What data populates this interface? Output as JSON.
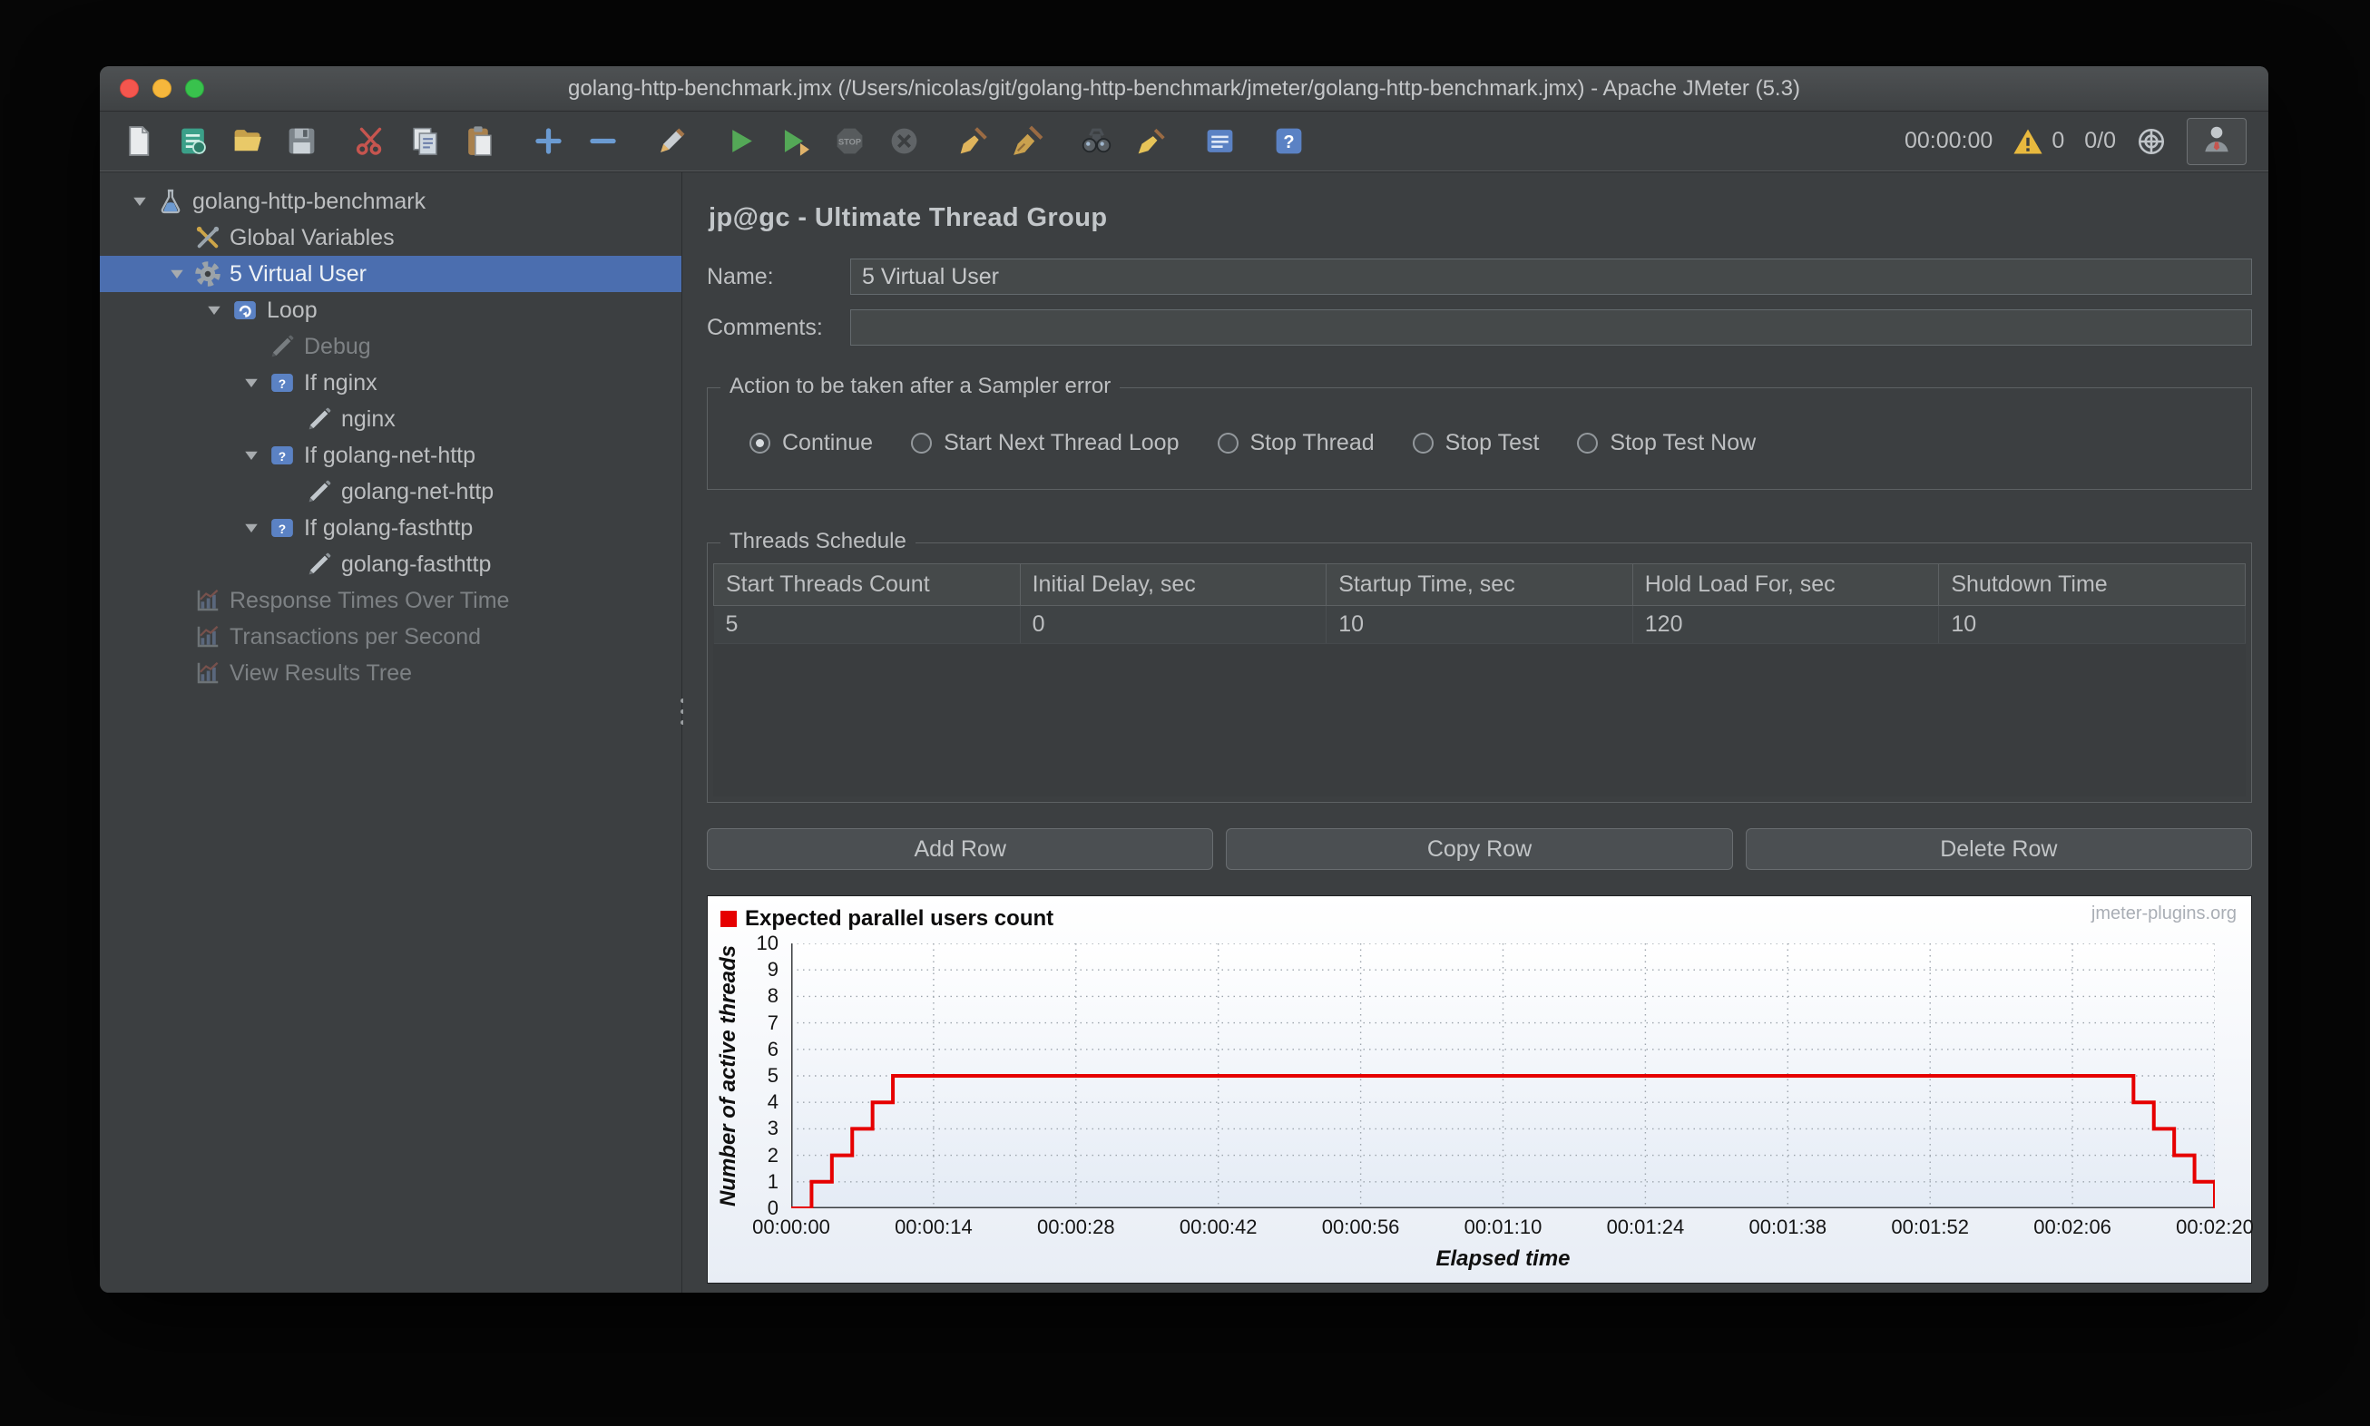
{
  "window": {
    "title": "golang-http-benchmark.jmx (/Users/nicolas/git/golang-http-benchmark/jmeter/golang-http-benchmark.jmx) - Apache JMeter (5.3)"
  },
  "colors": {
    "tree_selection": "#4b6eaf",
    "series_red": "#e60000"
  },
  "toolbar": {
    "icons": [
      {
        "name": "new-file-icon"
      },
      {
        "name": "templates-icon"
      },
      {
        "name": "open-file-icon"
      },
      {
        "name": "save-icon"
      },
      {
        "name": "cut-icon",
        "gap": true
      },
      {
        "name": "copy-icon"
      },
      {
        "name": "paste-icon"
      },
      {
        "name": "add-icon",
        "gap": true
      },
      {
        "name": "remove-icon"
      },
      {
        "name": "toggle-icon",
        "gap": true
      },
      {
        "name": "start-icon",
        "gap": true
      },
      {
        "name": "start-no-timers-icon"
      },
      {
        "name": "stop-icon",
        "disabled": true
      },
      {
        "name": "shutdown-icon",
        "disabled": true
      },
      {
        "name": "clear-icon",
        "gap": true
      },
      {
        "name": "clear-all-icon"
      },
      {
        "name": "search-icon",
        "gap": true
      },
      {
        "name": "clear-search-icon"
      },
      {
        "name": "function-helper-icon",
        "gap": true
      },
      {
        "name": "help-icon",
        "gap": true
      }
    ],
    "timer": "00:00:00",
    "warning_count": "0",
    "active_threads": "0/0"
  },
  "tree": {
    "items": [
      {
        "label": "golang-http-benchmark",
        "level": 0,
        "icon": "test-plan",
        "expanded": true,
        "enabled": true
      },
      {
        "label": "Global Variables",
        "level": 1,
        "icon": "variables",
        "enabled": true
      },
      {
        "label": "5 Virtual User",
        "level": 1,
        "icon": "thread-group",
        "expanded": true,
        "selected": true,
        "enabled": true
      },
      {
        "label": "Loop",
        "level": 2,
        "icon": "loop-controller",
        "expanded": true,
        "enabled": true
      },
      {
        "label": "Debug",
        "level": 3,
        "icon": "sampler",
        "enabled": false
      },
      {
        "label": "If nginx",
        "level": 3,
        "icon": "if-controller",
        "expanded": true,
        "enabled": true
      },
      {
        "label": "nginx",
        "level": 4,
        "icon": "sampler",
        "enabled": true
      },
      {
        "label": "If golang-net-http",
        "level": 3,
        "icon": "if-controller",
        "expanded": true,
        "enabled": true
      },
      {
        "label": "golang-net-http",
        "level": 4,
        "icon": "sampler",
        "enabled": true
      },
      {
        "label": "If golang-fasthttp",
        "level": 3,
        "icon": "if-controller",
        "expanded": true,
        "enabled": true
      },
      {
        "label": "golang-fasthttp",
        "level": 4,
        "icon": "sampler",
        "enabled": true
      },
      {
        "label": "Response Times Over Time",
        "level": 1,
        "icon": "listener",
        "enabled": false
      },
      {
        "label": "Transactions per Second",
        "level": 1,
        "icon": "listener",
        "enabled": false
      },
      {
        "label": "View Results Tree",
        "level": 1,
        "icon": "listener",
        "enabled": false
      }
    ]
  },
  "main": {
    "title": "jp@gc - Ultimate Thread Group",
    "name": {
      "label": "Name:",
      "value": "5 Virtual User"
    },
    "comments": {
      "label": "Comments:",
      "value": ""
    },
    "error_action": {
      "title": "Action to be taken after a Sampler error",
      "options": [
        {
          "label": "Continue",
          "selected": true
        },
        {
          "label": "Start Next Thread Loop",
          "selected": false
        },
        {
          "label": "Stop Thread",
          "selected": false
        },
        {
          "label": "Stop Test",
          "selected": false
        },
        {
          "label": "Stop Test Now",
          "selected": false
        }
      ]
    },
    "threads_schedule": {
      "title": "Threads Schedule",
      "columns": [
        "Start Threads Count",
        "Initial Delay, sec",
        "Startup Time, sec",
        "Hold Load For, sec",
        "Shutdown Time"
      ],
      "rows": [
        [
          "5",
          "0",
          "10",
          "120",
          "10"
        ]
      ]
    },
    "row_buttons": [
      {
        "label": "Add Row"
      },
      {
        "label": "Copy Row"
      },
      {
        "label": "Delete Row"
      }
    ]
  },
  "chart_data": {
    "type": "line",
    "title": "Expected parallel users count",
    "watermark": "jmeter-plugins.org",
    "xlabel": "Elapsed time",
    "ylabel": "Number of active threads",
    "ylim": [
      0,
      10
    ],
    "y_tick_step": 1,
    "xlim_seconds": [
      0,
      140
    ],
    "grid": true,
    "legend_position": "top-left",
    "x_ticks": [
      {
        "t": 0,
        "label": "00:00:00"
      },
      {
        "t": 14,
        "label": "00:00:14"
      },
      {
        "t": 28,
        "label": "00:00:28"
      },
      {
        "t": 42,
        "label": "00:00:42"
      },
      {
        "t": 56,
        "label": "00:00:56"
      },
      {
        "t": 70,
        "label": "00:01:10"
      },
      {
        "t": 84,
        "label": "00:01:24"
      },
      {
        "t": 98,
        "label": "00:01:38"
      },
      {
        "t": 112,
        "label": "00:01:52"
      },
      {
        "t": 126,
        "label": "00:02:06"
      },
      {
        "t": 140,
        "label": "00:02:20"
      }
    ],
    "series": [
      {
        "name": "Expected parallel users count",
        "color": "#e60000",
        "interpolation": "step-after",
        "points": [
          [
            0,
            0
          ],
          [
            2,
            1
          ],
          [
            4,
            2
          ],
          [
            6,
            3
          ],
          [
            8,
            4
          ],
          [
            10,
            5
          ],
          [
            130,
            5
          ],
          [
            132,
            4
          ],
          [
            134,
            3
          ],
          [
            136,
            2
          ],
          [
            138,
            1
          ],
          [
            140,
            0
          ]
        ]
      }
    ]
  }
}
